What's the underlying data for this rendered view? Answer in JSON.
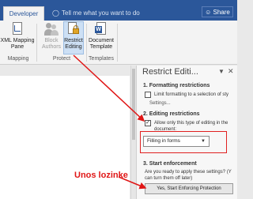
{
  "tabs": {
    "active": "Developer",
    "tell_me": "Tell me what you want to do",
    "share": "Share"
  },
  "ribbon": {
    "xml_mapping": [
      "XML Mapping",
      "Pane"
    ],
    "block_authors": [
      "Block",
      "Authors"
    ],
    "restrict_editing": [
      "Restrict",
      "Editing"
    ],
    "document_template": [
      "Document",
      "Template"
    ],
    "group_mapping": "Mapping",
    "group_protect": "Protect",
    "group_templates": "Templates"
  },
  "pane": {
    "title": "Restrict Editi...",
    "sec1_title": "1. Formatting restrictions",
    "sec1_checkbox": "Limit formatting to a selection of sty",
    "settings_link": "Settings...",
    "sec2_title": "2. Editing restrictions",
    "sec2_checkbox_line1": "Allow only this type of editing in the",
    "sec2_checkbox_line2": "document:",
    "editing_type": "Filling in forms",
    "sec3_title": "3. Start enforcement",
    "enforce_q_line1": "Are you ready to apply these settings? (Y",
    "enforce_q_line2": "can turn them off later)",
    "enforce_button": "Yes, Start Enforcing Protection"
  },
  "annotation": "Unos lozinke",
  "colors": {
    "tab_bar": "#2b579a",
    "annotation": "#e01616",
    "highlight": "#cde0f5"
  }
}
